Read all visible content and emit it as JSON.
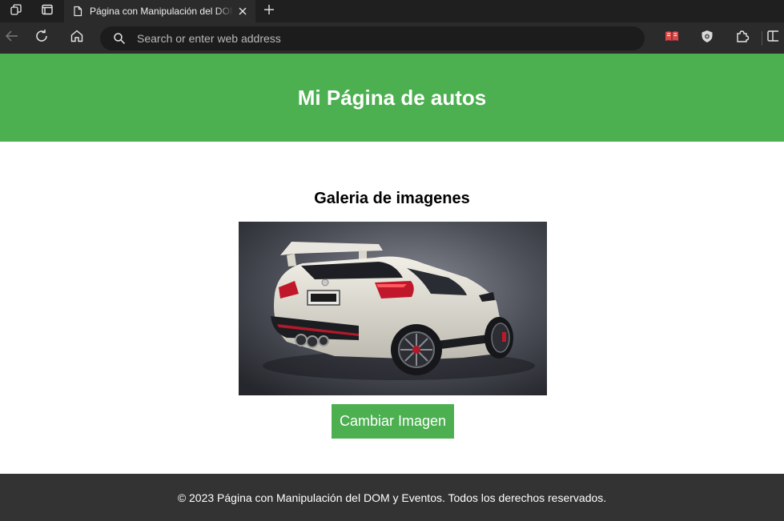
{
  "browser": {
    "tab": {
      "title": "Página con Manipulación del DOM y Eventos",
      "icon": "document-icon"
    },
    "address_bar": {
      "placeholder": "Search or enter web address",
      "value": ""
    },
    "icons": {
      "workspaces": "workspaces-icon",
      "tab_actions": "tab-actions-icon",
      "close_tab": "close-icon",
      "new_tab": "plus-icon",
      "back": "back-arrow-icon",
      "refresh": "refresh-icon",
      "home": "home-icon",
      "search": "search-icon",
      "reader": "book-icon",
      "shield": "shield-icon",
      "extensions": "puzzle-icon",
      "split_screen": "split-screen-icon"
    }
  },
  "page": {
    "header": {
      "title": "Mi Página de autos",
      "color": "#4caf50"
    },
    "gallery": {
      "title": "Galeria de imagenes",
      "image_subject": "white sports hatchback car, rear three-quarter view",
      "button_label": "Cambiar Imagen"
    },
    "footer": {
      "text": "© 2023 Página con Manipulación del DOM y Eventos. Todos los derechos reservados.",
      "color": "#333333"
    }
  }
}
